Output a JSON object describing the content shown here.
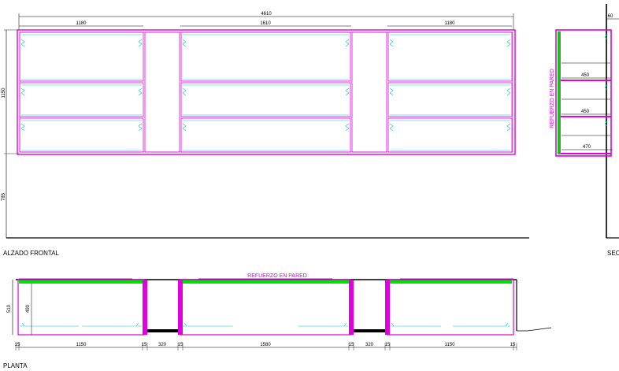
{
  "views": {
    "front": {
      "label": "ALZADO FRONTAL"
    },
    "section": {
      "label": "SEC"
    },
    "plan": {
      "label": "PLANTA"
    }
  },
  "notes": {
    "wall_reinforcement": "REFUERZO EN PARED"
  },
  "front_dims": {
    "total": "4610",
    "module_left": "1180",
    "module_center": "1610",
    "module_right": "1180",
    "height_cabinet": "1150",
    "height_floor": "785"
  },
  "section_dims": {
    "top": "60",
    "shelf1": "450",
    "shelf2": "450",
    "shelf3": "470"
  },
  "plan_dims": {
    "depth_outer": "510",
    "depth_inner": "490",
    "seq": [
      "15",
      "1150",
      "15",
      "320",
      "15",
      "1580",
      "15",
      "320",
      "15",
      "1150",
      "15"
    ]
  },
  "colors": {
    "panel": "#e000e0",
    "hinge": "#00c8e0",
    "reinforcement": "#00e000",
    "line": "#000000"
  }
}
